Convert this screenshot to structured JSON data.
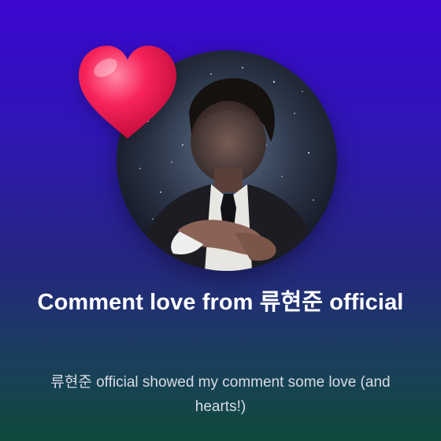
{
  "notification": {
    "title": "Comment love from 류현준 official",
    "message": "류현준 official showed my comment some love (and hearts!)",
    "avatar_icon": "profile-photo",
    "reaction_icon": "heart-icon"
  },
  "colors": {
    "background_top": "#3c07d2",
    "background_bottom": "#0f4a3b",
    "heart": "#f7245a",
    "title_text": "#ffffff",
    "subtitle_text": "#d9dbe6"
  }
}
